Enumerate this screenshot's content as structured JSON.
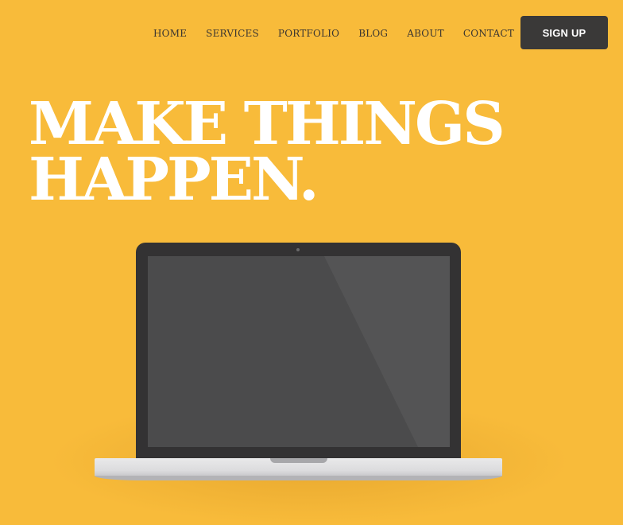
{
  "nav": {
    "links": [
      {
        "label": "HOME"
      },
      {
        "label": "SERVICES"
      },
      {
        "label": "PORTFOLIO"
      },
      {
        "label": "BLOG"
      },
      {
        "label": "ABOUT"
      },
      {
        "label": "CONTACT"
      }
    ],
    "signup_label": "SIGN UP"
  },
  "hero": {
    "title_line1": "MAKE THINGS",
    "title_line2": "HAPPEN."
  },
  "colors": {
    "background": "#f8bb3a",
    "button": "#3a3938",
    "title": "#ffffff",
    "nav_text": "#3a3530"
  },
  "icons": {
    "device": "laptop-icon"
  }
}
